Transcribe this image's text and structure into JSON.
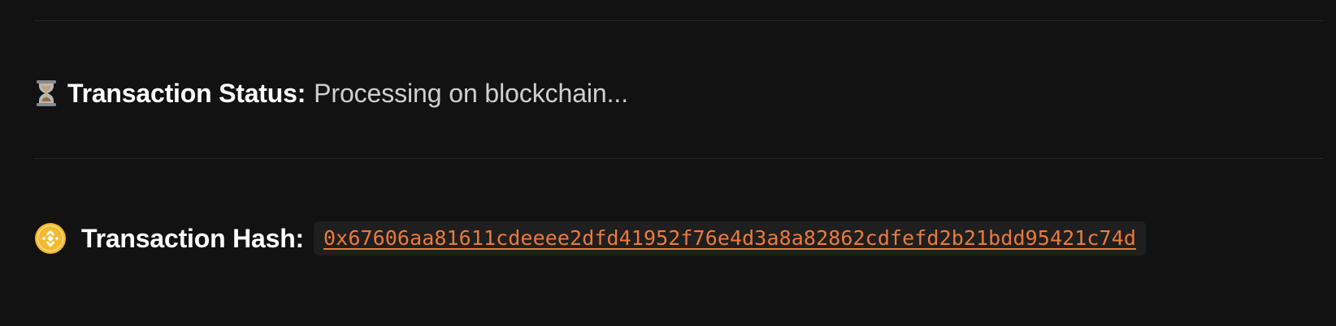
{
  "status": {
    "icon": "hourglass-icon",
    "label": "Transaction Status:",
    "value": "Processing on blockchain..."
  },
  "hash": {
    "icon": "bnb-coin-icon",
    "label": "Transaction Hash:",
    "value": "0x67606aa81611cdeeee2dfd41952f76e4d3a8a82862cdfefd2b21bdd95421c74d"
  },
  "colors": {
    "background": "#121212",
    "divider": "#262626",
    "link": "#ee7a3a",
    "chip_background": "#1f1f1f",
    "coin": "#f3ba2f"
  }
}
